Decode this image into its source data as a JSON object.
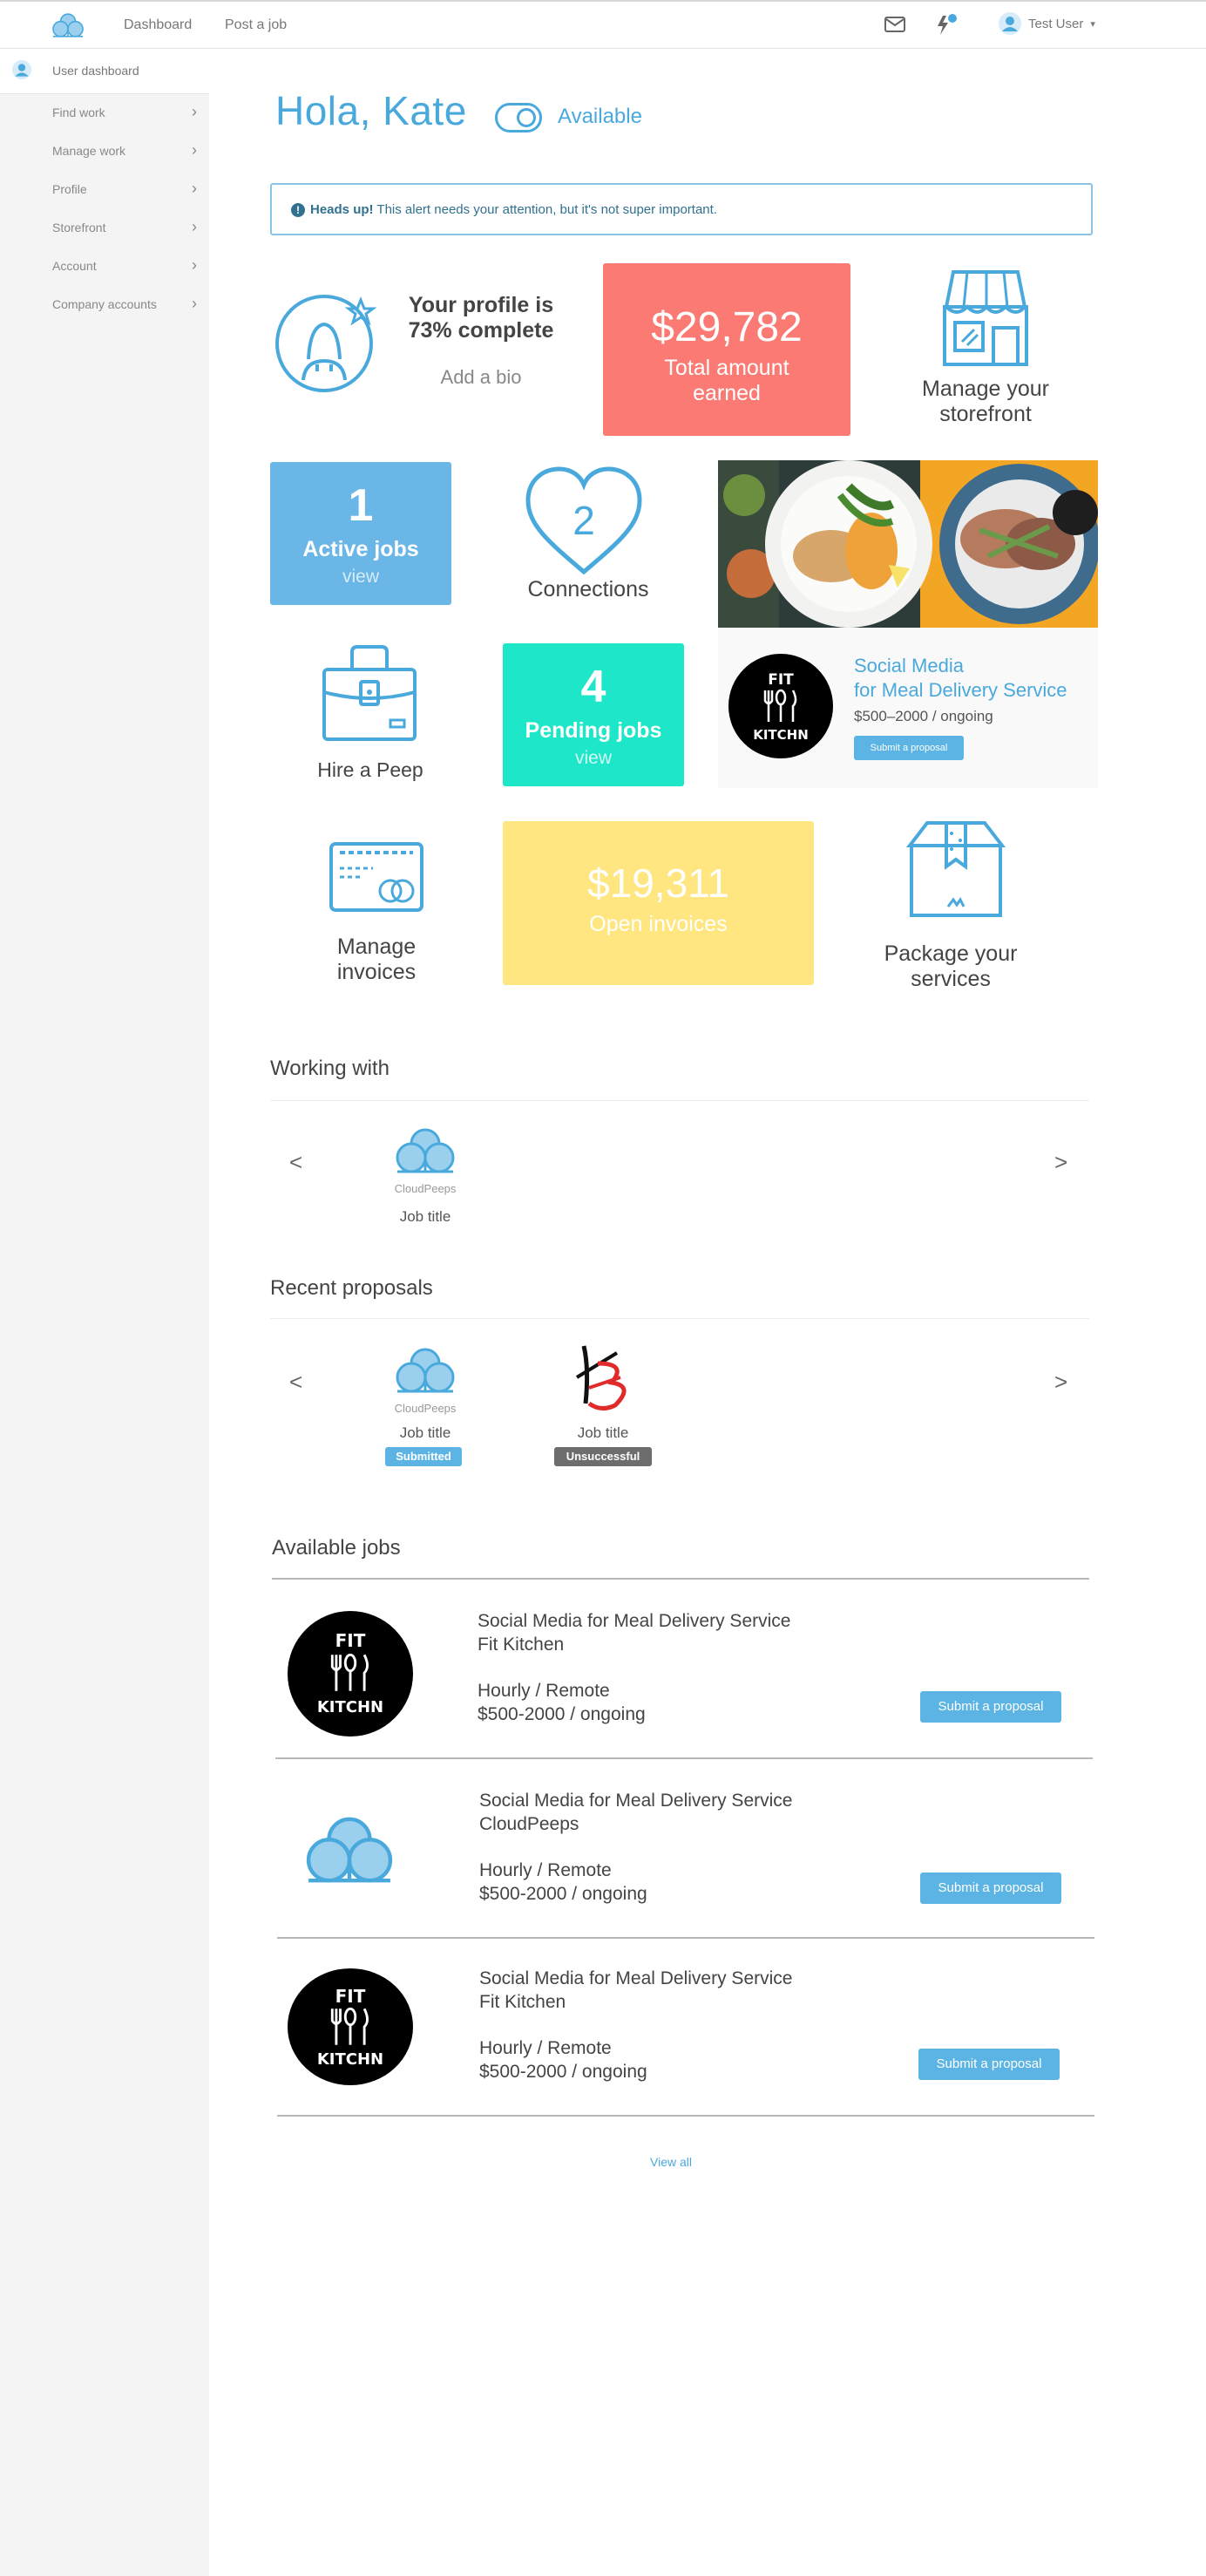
{
  "nav": {
    "dashboard": "Dashboard",
    "post_job": "Post a job",
    "user_name": "Test User",
    "caret": "▾"
  },
  "sidebar": {
    "top_label": "User dashboard",
    "items": [
      {
        "label": "Find work"
      },
      {
        "label": "Manage work"
      },
      {
        "label": "Profile"
      },
      {
        "label": "Storefront"
      },
      {
        "label": "Account"
      },
      {
        "label": "Company accounts"
      }
    ],
    "chevron": "›"
  },
  "header": {
    "greeting": "Hola, Kate",
    "status": "Available"
  },
  "alert": {
    "icon": "!",
    "strong": "Heads up!",
    "text": " This alert needs your attention, but it's not super important."
  },
  "profile": {
    "line1": "Your profile is",
    "line2": "73% complete",
    "action": "Add a bio"
  },
  "earned": {
    "amount": "$29,782",
    "line1": "Total amount",
    "line2": "earned"
  },
  "storefront": {
    "line1": "Manage your",
    "line2": "storefront"
  },
  "active_jobs": {
    "count": "1",
    "label": "Active jobs",
    "link": "view"
  },
  "connections": {
    "count": "2",
    "label": "Connections"
  },
  "featured_job": {
    "title_line1": "Social Media",
    "title_line2": "for Meal Delivery Service",
    "budget": "$500–2000 / ongoing",
    "button": "Submit a proposal"
  },
  "hire": {
    "label": "Hire a Peep"
  },
  "pending_jobs": {
    "count": "4",
    "label": "Pending jobs",
    "link": "view"
  },
  "invoices": {
    "line1": "Manage",
    "line2": "invoices"
  },
  "open_invoices": {
    "amount": "$19,311",
    "label": "Open invoices"
  },
  "package": {
    "line1": "Package your",
    "line2": "services"
  },
  "working_with": {
    "title": "Working with",
    "prev": "<",
    "next": ">",
    "items": [
      {
        "company": "CloudPeeps",
        "job": "Job title"
      }
    ]
  },
  "recent_proposals": {
    "title": "Recent proposals",
    "prev": "<",
    "next": ">",
    "items": [
      {
        "company": "CloudPeeps",
        "job": "Job title",
        "status": "Submitted"
      },
      {
        "job": "Job title",
        "status": "Unsuccessful"
      }
    ]
  },
  "logos": {
    "fit_top": "FIT",
    "fit_bottom": "KITCHN"
  },
  "available_jobs": {
    "title": "Available jobs",
    "items": [
      {
        "title": "Social Media for Meal Delivery Service",
        "company": "Fit Kitchen",
        "type": "Hourly / Remote",
        "budget": "$500-2000 / ongoing",
        "button": "Submit a proposal"
      },
      {
        "title": "Social Media for Meal Delivery Service",
        "company": "CloudPeeps",
        "type": "Hourly / Remote",
        "budget": "$500-2000 / ongoing",
        "button": "Submit a proposal"
      },
      {
        "title": "Social Media for Meal Delivery Service",
        "company": "Fit Kitchen",
        "type": "Hourly / Remote",
        "budget": "$500-2000 / ongoing",
        "button": "Submit a proposal"
      }
    ],
    "view_all": "View all"
  },
  "colors": {
    "accent": "#4aa9dc",
    "earned_bg": "#fb7a73",
    "active_bg": "#6ab6e6",
    "pending_bg": "#1ee6c8",
    "invoice_bg": "#ffe680",
    "badge_submitted": "#5bb4e4",
    "badge_unsuccessful": "#6d6d6d"
  }
}
